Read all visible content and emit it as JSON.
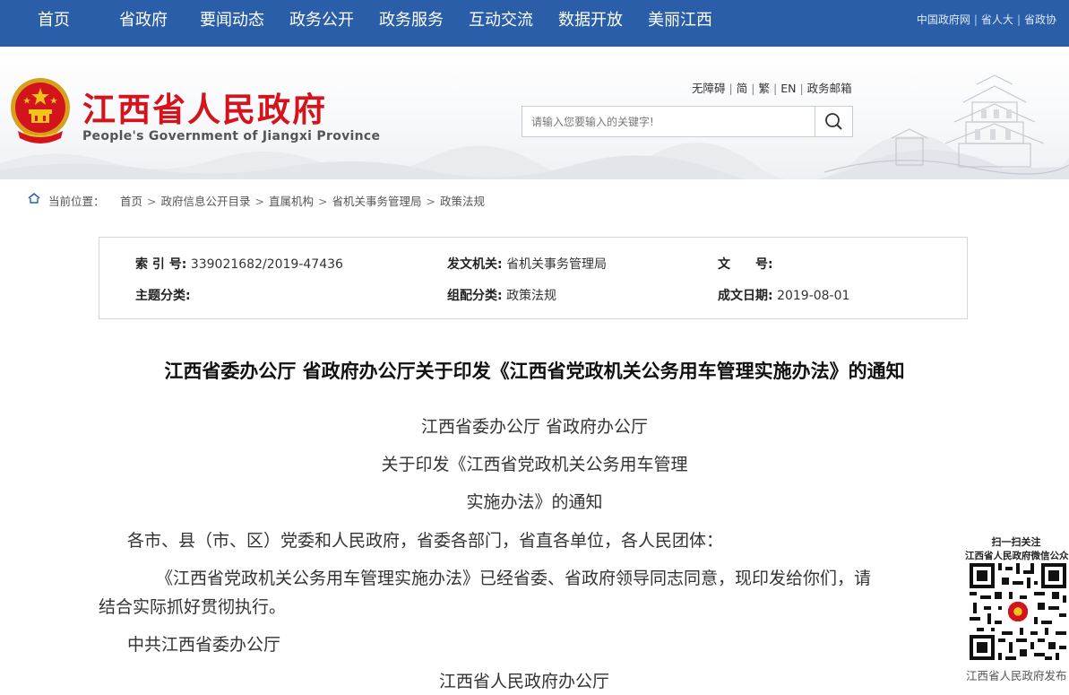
{
  "topnav": {
    "items": [
      "首页",
      "省政府",
      "要闻动态",
      "政务公开",
      "政务服务",
      "互动交流",
      "数据开放",
      "美丽江西"
    ],
    "links": [
      "中国政府网",
      "省人大",
      "省政协"
    ]
  },
  "header": {
    "site_title": "江西省人民政府",
    "site_subtitle": "People's Government of Jiangxi Province",
    "access_links": [
      "无障碍",
      "简",
      "繁",
      "EN",
      "政务邮箱"
    ],
    "search_placeholder": "请输入您要输入的关键字!"
  },
  "breadcrumb": {
    "label": "当前位置：",
    "items": [
      "首页",
      "政府信息公开目录",
      "直属机构",
      "省机关事务管理局",
      "政策法规"
    ]
  },
  "meta": {
    "index_no_label": "索 引 号:",
    "index_no": "339021682/2019-47436",
    "issuer_label": "发文机关:",
    "issuer": "省机关事务管理局",
    "doc_no_label": "文　　号:",
    "doc_no": "",
    "topic_label": "主题分类:",
    "topic": "",
    "category_label": "组配分类:",
    "category": "政策法规",
    "date_label": "成文日期:",
    "date": "2019-08-01"
  },
  "article": {
    "title": "江西省委办公厅 省政府办公厅关于印发《江西省党政机关公务用车管理实施办法》的通知",
    "head_line1": "江西省委办公厅 省政府办公厅",
    "head_line2": "关于印发《江西省党政机关公务用车管理",
    "head_line3": "实施办法》的通知",
    "salutation": "各市、县（市、区）党委和人民政府，省委各部门，省直各单位，各人民团体：",
    "body_line1": "《江西省党政机关公务用车管理实施办法》已经省委、省政府领导同志同意，现印发给你们，请",
    "body_line2": "结合实际抓好贯彻执行。",
    "sign1": "中共江西省委办公厅",
    "sign2": "江西省人民政府办公厅"
  },
  "qr": {
    "line1": "扫一扫关注",
    "line2": "江西省人民政府微信公众号",
    "caption": "江西省人民政府发布"
  },
  "colors": {
    "nav_bg": "#2b5ea8",
    "brand_red": "#d4141c"
  }
}
